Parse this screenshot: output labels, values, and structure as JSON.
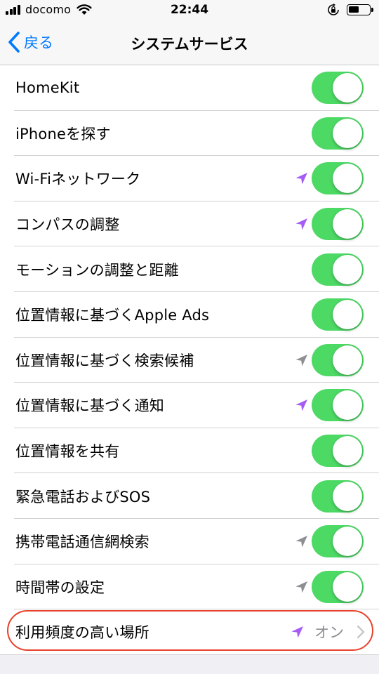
{
  "status_bar": {
    "carrier": "docomo",
    "time": "22:44",
    "icons": [
      "signal-icon",
      "wifi-icon",
      "rotation-lock-icon",
      "battery-icon"
    ]
  },
  "nav": {
    "back_label": "戻る",
    "title": "システムサービス"
  },
  "colors": {
    "accent": "#007aff",
    "toggle_on": "#4cd964",
    "location_active": "#a55cf5",
    "location_recent": "#8e8e93",
    "highlight": "#e8402a"
  },
  "rows": [
    {
      "label": "HomeKit",
      "arrow": "none",
      "toggle": true
    },
    {
      "label": "iPhoneを探す",
      "arrow": "none",
      "toggle": true
    },
    {
      "label": "Wi-Fiネットワーク",
      "arrow": "purple",
      "toggle": true
    },
    {
      "label": "コンパスの調整",
      "arrow": "purple",
      "toggle": true
    },
    {
      "label": "モーションの調整と距離",
      "arrow": "none",
      "toggle": true
    },
    {
      "label": "位置情報に基づくApple Ads",
      "arrow": "none",
      "toggle": true
    },
    {
      "label": "位置情報に基づく検索候補",
      "arrow": "gray",
      "toggle": true
    },
    {
      "label": "位置情報に基づく通知",
      "arrow": "purple",
      "toggle": true
    },
    {
      "label": "位置情報を共有",
      "arrow": "none",
      "toggle": true
    },
    {
      "label": "緊急電話およびSOS",
      "arrow": "none",
      "toggle": true
    },
    {
      "label": "携帯電話通信網検索",
      "arrow": "gray",
      "toggle": true
    },
    {
      "label": "時間帯の設定",
      "arrow": "gray",
      "toggle": true
    }
  ],
  "last_row": {
    "label": "利用頻度の高い場所",
    "arrow": "purple",
    "value": "オン"
  }
}
